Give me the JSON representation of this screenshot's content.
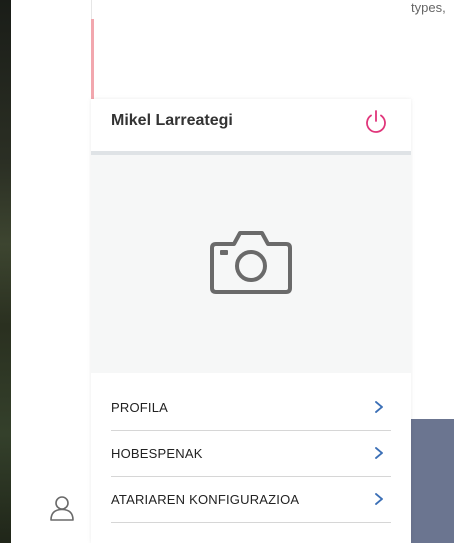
{
  "page": {
    "fragment_text": "types,"
  },
  "user_panel": {
    "name": "Mikel Larreategi"
  },
  "menu": [
    {
      "label": "PROFILA",
      "icon": "chevron-right-icon"
    },
    {
      "label": "HOBESPENAK",
      "icon": "chevron-right-icon"
    },
    {
      "label": "ATARIAREN KONFIGURAZIOA",
      "icon": "chevron-right-icon"
    }
  ],
  "icons": {
    "power": "power-icon",
    "camera": "camera-icon",
    "user": "user-icon"
  },
  "colors": {
    "accent_pink": "#f2a7ae",
    "power_icon": "#e0357a",
    "chevron": "#3b6fb6",
    "placeholder_icon": "#6a6a6a",
    "side_block": "#6b7590"
  }
}
